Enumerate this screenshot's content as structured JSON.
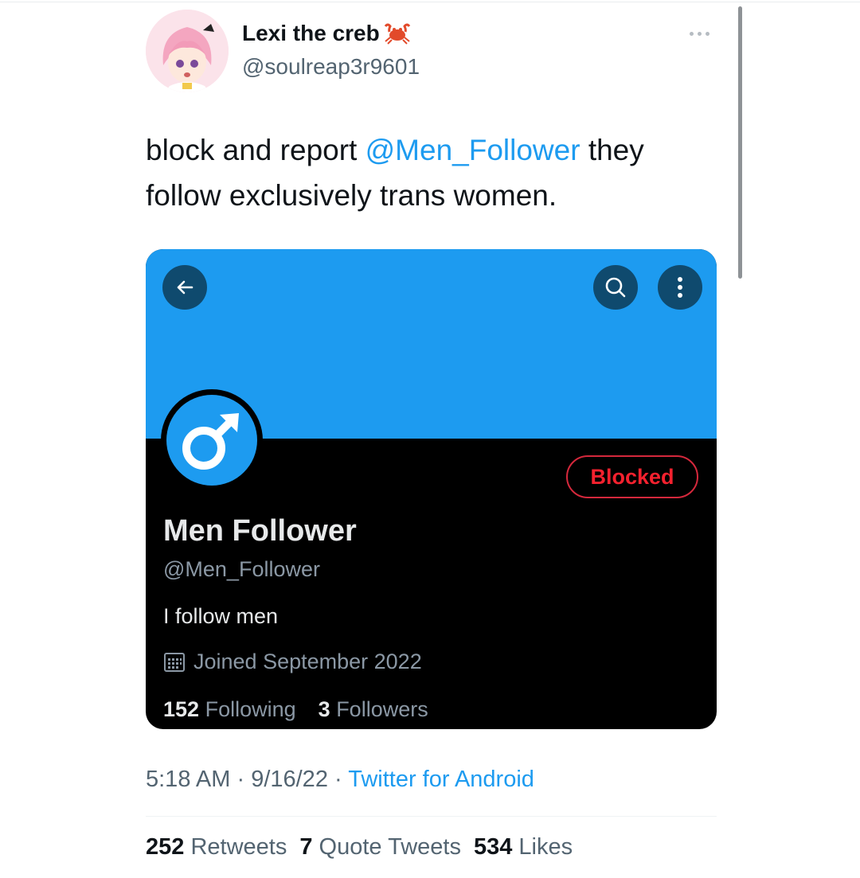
{
  "author": {
    "display_name": "Lexi the creb",
    "name_emoji_icon": "crab-icon",
    "handle": "@soulreap3r9601",
    "avatar_icon": "anime-girl-avatar"
  },
  "tweet": {
    "text_before": "block and report ",
    "mention": "@Men_Follower",
    "text_after": " they follow exclusively trans women."
  },
  "embedded_profile": {
    "banner_color": "#1d9bf0",
    "back_icon": "arrow-left-icon",
    "search_icon": "search-icon",
    "menu_icon": "vertical-dots-icon",
    "avatar_icon": "male-symbol-icon",
    "blocked_label": "Blocked",
    "name": "Men Follower",
    "handle": "@Men_Follower",
    "bio": "I follow men",
    "joined_icon": "calendar-icon",
    "joined": "Joined September 2022",
    "following_count": "152",
    "following_label": "Following",
    "followers_count": "3",
    "followers_label": "Followers"
  },
  "meta": {
    "time": "5:18 AM",
    "date": "9/16/22",
    "separator": " · ",
    "source": "Twitter for Android"
  },
  "counts": {
    "retweets_count": "252",
    "retweets_label": "Retweets",
    "quotes_count": "7",
    "quotes_label": "Quote Tweets",
    "likes_count": "534",
    "likes_label": "Likes"
  },
  "colors": {
    "accent": "#1d9bf0",
    "blocked_red": "#f4212e",
    "text_dark": "#0f1419",
    "text_muted": "#536471"
  }
}
